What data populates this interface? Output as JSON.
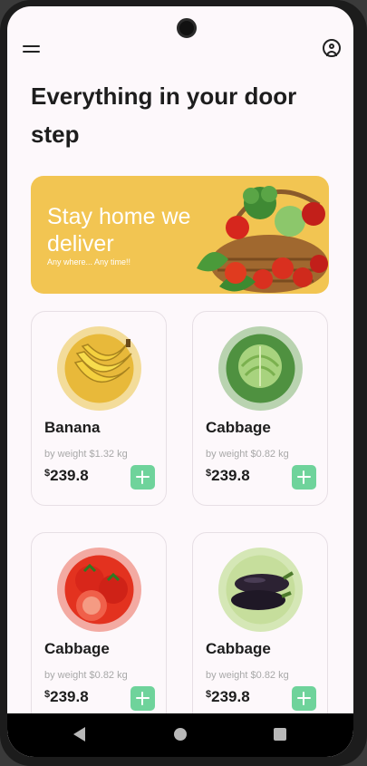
{
  "header": {
    "menu_icon": "hamburger-menu-icon",
    "profile_icon": "user-circle-icon",
    "title": "Everything in your door step"
  },
  "banner": {
    "headline": "Stay home we deliver",
    "subtitle": "Any where... Any time!!",
    "background_color": "#f2c552"
  },
  "products": [
    {
      "name": "Banana",
      "weight": "by weight $1.32 kg",
      "currency": "$",
      "price": "239.8",
      "icon": "banana-icon",
      "thumb_color": "#f3dc9a"
    },
    {
      "name": "Cabbage",
      "weight": "by weight $0.82 kg",
      "currency": "$",
      "price": "239.8",
      "icon": "cabbage-icon",
      "thumb_color": "#b9d3b0"
    },
    {
      "name": "Cabbage",
      "weight": "by weight $0.82 kg",
      "currency": "$",
      "price": "239.8",
      "icon": "tomato-icon",
      "thumb_color": "#f3aaa2"
    },
    {
      "name": "Cabbage",
      "weight": "by weight $0.82 kg",
      "currency": "$",
      "price": "239.8",
      "icon": "eggplant-icon",
      "thumb_color": "#d5e7b6"
    }
  ],
  "add_button_color": "#6fd39b",
  "nav": {
    "back_icon": "back-triangle-icon",
    "home_icon": "home-circle-icon",
    "recent_icon": "recent-square-icon"
  }
}
